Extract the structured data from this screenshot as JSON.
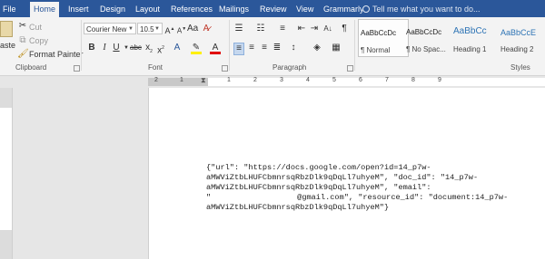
{
  "tabs": [
    "File",
    "Home",
    "Insert",
    "Design",
    "Layout",
    "References",
    "Mailings",
    "Review",
    "View",
    "Grammarly"
  ],
  "tell_me": "Tell me what you want to do...",
  "clipboard": {
    "paste": "aste",
    "cut": "Cut",
    "copy": "Copy",
    "format_painter": "Format Painter",
    "label": "Clipboard"
  },
  "font": {
    "family": "Courier New",
    "size": "10.5",
    "label": "Font"
  },
  "paragraph": {
    "label": "Paragraph"
  },
  "styles": {
    "label": "Styles",
    "items": [
      {
        "preview": "AaBbCcDc",
        "name": "¶ Normal"
      },
      {
        "preview": "AaBbCcDc",
        "name": "¶ No Spac..."
      },
      {
        "preview": "AaBbCc",
        "name": "Heading 1"
      },
      {
        "preview": "AaBbCcE",
        "name": "Heading 2"
      }
    ]
  },
  "ruler_numbers": [
    "2",
    "1",
    "1",
    "2",
    "3",
    "4",
    "5",
    "6",
    "7",
    "8",
    "9"
  ],
  "document_lines": [
    "{\"url\": \"https://docs.google.com/open?id=14_p7w-",
    "aMWViZtbLHUFCbmnrsqRbzDlk9qDqLl7uhyeM\", \"doc_id\": \"14_p7w-",
    "aMWViZtbLHUFCbmnrsqRbzDlk9qDqLl7uhyeM\", \"email\":",
    "\"",
    "@gmail.com\", \"resource_id\": \"document:14_p7w-",
    "aMWViZtbLHUFCbmnrsqRbzDlk9qDqLl7uhyeM\"}"
  ]
}
